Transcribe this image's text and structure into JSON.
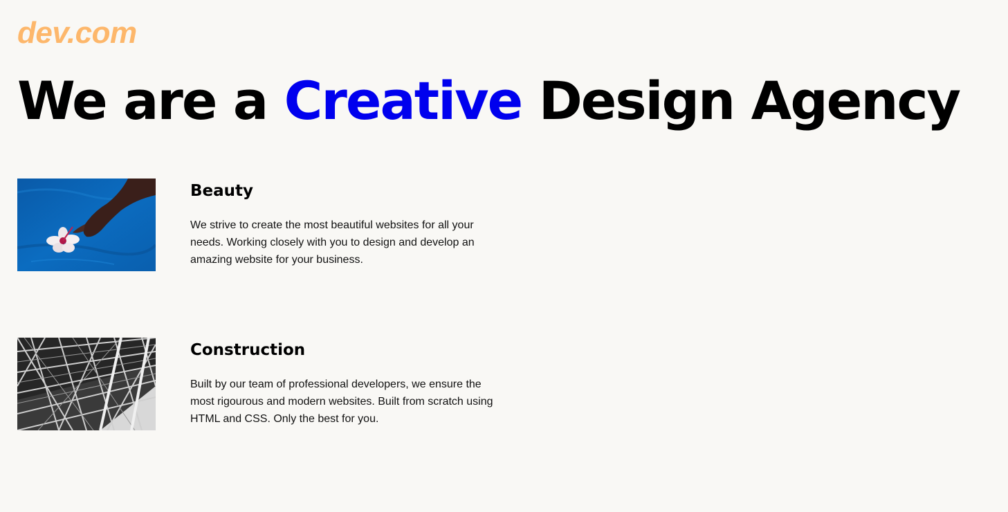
{
  "brand": {
    "logo": "dev.com",
    "logo_color": "#fdb76b"
  },
  "hero": {
    "prefix": "We are a",
    "accent": "Creative",
    "suffix": "Design Agency",
    "accent_color": "#0000ee"
  },
  "features": [
    {
      "title": "Beauty",
      "text": "We strive to create the most beautiful websites for all your needs. Working closely with you to design and develop an amazing website for your business.",
      "image": "hand-flower-water-photo"
    },
    {
      "title": "Construction",
      "text": "Built by our team of professional developers, we ensure the most rigourous and modern websites. Built from scratch using HTML and CSS. Only the best for you.",
      "image": "steel-structure-photo"
    }
  ],
  "colors": {
    "background": "#f9f8f5",
    "text": "#000000"
  }
}
